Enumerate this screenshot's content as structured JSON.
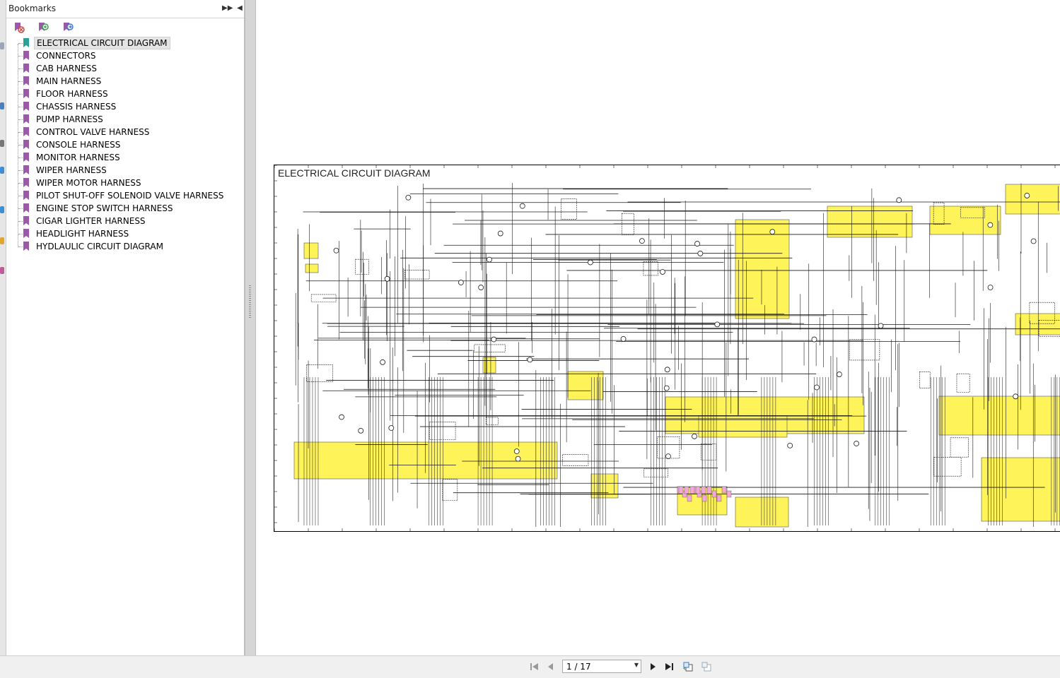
{
  "bookmarks_panel": {
    "title": "Bookmarks",
    "header_buttons": {
      "options_icon": "double-arrow-right-icon",
      "collapse_icon": "triangle-left-icon"
    },
    "toolbar": [
      {
        "name": "delete-bookmark-icon"
      },
      {
        "name": "add-bookmark-icon"
      },
      {
        "name": "expand-bookmark-icon"
      }
    ],
    "items": [
      {
        "label": "ELECTRICAL CIRCUIT DIAGRAM",
        "selected": true
      },
      {
        "label": "CONNECTORS"
      },
      {
        "label": "CAB HARNESS"
      },
      {
        "label": "MAIN HARNESS"
      },
      {
        "label": "FLOOR HARNESS"
      },
      {
        "label": "CHASSIS HARNESS"
      },
      {
        "label": "PUMP HARNESS"
      },
      {
        "label": "CONTROL VALVE HARNESS"
      },
      {
        "label": "CONSOLE HARNESS"
      },
      {
        "label": "MONITOR HARNESS"
      },
      {
        "label": "WIPER HARNESS"
      },
      {
        "label": "WIPER MOTOR HARNESS"
      },
      {
        "label": "PILOT SHUT-OFF SOLENOID VALVE HARNESS"
      },
      {
        "label": "ENGINE STOP SWITCH HARNESS"
      },
      {
        "label": "CIGAR LIGHTER HARNESS"
      },
      {
        "label": "HEADLIGHT HARNESS"
      },
      {
        "label": "HYDLAULIC CIRCUIT DIAGRAM"
      }
    ]
  },
  "document": {
    "diagram_title": "ELECTRICAL CIRCUIT DIAGRAM"
  },
  "navigation": {
    "page_display": "1 / 17",
    "buttons": [
      "first-page-icon",
      "previous-page-icon",
      "next-page-icon",
      "last-page-icon",
      "previous-view-icon",
      "next-view-icon"
    ]
  },
  "colors": {
    "bookmark_icon": "#9b5aa8",
    "bookmark_icon_selected": "#2aa198",
    "diagram_highlight": "#fff35a",
    "diagram_line": "#1a1a1a",
    "connector_pink": "#f2a8d8"
  }
}
